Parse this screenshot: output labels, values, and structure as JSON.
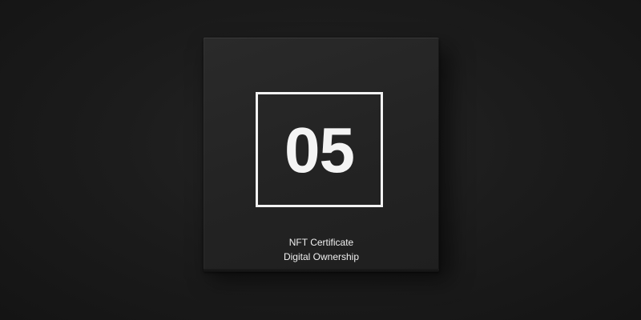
{
  "card": {
    "number": "05",
    "caption_line1": "NFT Certificate",
    "caption_line2": "Digital Ownership"
  },
  "colors": {
    "background": "#1c1c1c",
    "card": "#262626",
    "foreground": "#f2f2f2"
  }
}
